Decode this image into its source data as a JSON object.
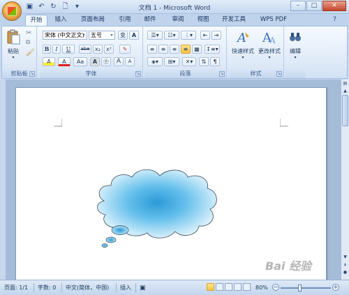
{
  "window": {
    "title": "文档 1 - Microsoft Word",
    "controls": {
      "minimize": "–",
      "maximize": "□",
      "close": "✕"
    }
  },
  "quick_access": {
    "save_icon": "save-icon",
    "undo_icon": "undo-icon",
    "redo_icon": "redo-icon",
    "print_icon": "print-preview-icon"
  },
  "tabs": [
    "开始",
    "插入",
    "页面布局",
    "引用",
    "邮件",
    "审阅",
    "视图",
    "开发工具",
    "WPS PDF"
  ],
  "ribbon": {
    "clipboard": {
      "label": "剪贴板",
      "paste_label": "粘贴"
    },
    "font": {
      "label": "字体",
      "font_name": "宋体 (中文正文)",
      "font_size": "五号",
      "char_shading": "变",
      "bold": "B",
      "italic": "I",
      "underline": "U",
      "strike": "abe",
      "subscript": "x₂",
      "superscript": "x²",
      "clear_format": "A",
      "highlight": "A",
      "font_color": "A",
      "change_case": "Aa",
      "char_border": "A",
      "enclose": "㊉",
      "grow": "A",
      "shrink": "A"
    },
    "paragraph": {
      "label": "段落"
    },
    "styles": {
      "label": "样式",
      "quick_styles": "快速样式",
      "change_styles": "更改样式"
    },
    "editing": {
      "label": "编辑",
      "editing_label": "编辑"
    }
  },
  "statusbar": {
    "page": "页面: 1/1",
    "words": "字数: 0",
    "language": "中文(简体，中国)",
    "insert": "插入",
    "zoom": "80%"
  },
  "watermark": "Bai 经验",
  "colors": {
    "accent": "#1e395b",
    "cloud_edge": "#9fd8f4",
    "cloud_center": "#2a9ad6"
  }
}
